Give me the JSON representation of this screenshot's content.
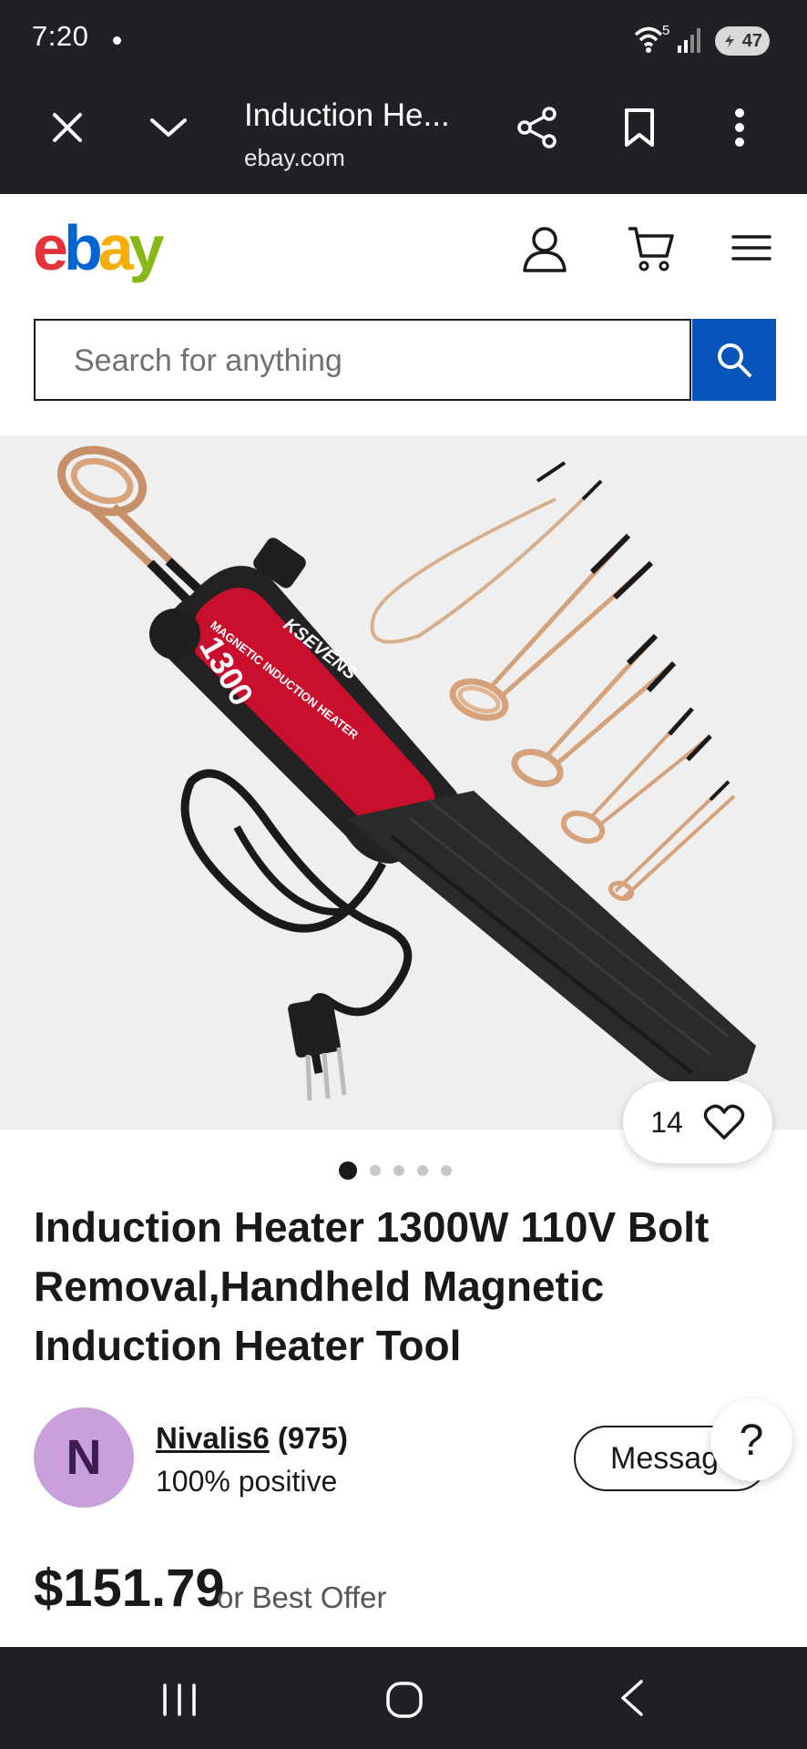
{
  "status_bar": {
    "time": "7:20",
    "battery": "47",
    "wifi_label": "5",
    "icons": [
      "wifi-icon",
      "signal-icon",
      "battery-icon"
    ]
  },
  "browser": {
    "tab_title": "Induction He...",
    "domain": "ebay.com",
    "icons": [
      "close-icon",
      "chevron-down-icon",
      "share-icon",
      "bookmark-icon",
      "more-vert-icon"
    ]
  },
  "header": {
    "logo_letters": [
      "e",
      "b",
      "a",
      "y"
    ],
    "logo_colors": [
      "#e53238",
      "#0064d2",
      "#f5af02",
      "#86b817"
    ],
    "icons": [
      "account-icon",
      "cart-icon",
      "menu-icon"
    ]
  },
  "search": {
    "placeholder": "Search for anything",
    "button_icon": "search-icon"
  },
  "gallery": {
    "watch_count": "14",
    "total_images": 5,
    "active_index": 0,
    "product_image_text": {
      "brand": "KSEVENS",
      "label": "MAGNETIC INDUCTION HEATER",
      "wattage": "1300"
    }
  },
  "listing": {
    "title": "Induction Heater 1300W 110V Bolt Removal,Handheld Magnetic Induction Heater Tool",
    "seller_initial": "N",
    "seller_name": "Nivalis6",
    "seller_feedback": "(975)",
    "seller_positive": "100% positive",
    "message_label": "Message",
    "help_label": "?",
    "price": "$151.79",
    "best_offer": "or Best Offer"
  },
  "colors": {
    "status_bg": "#202124",
    "search_button": "#0654ba",
    "avatar_bg": "#c9a0dc"
  }
}
